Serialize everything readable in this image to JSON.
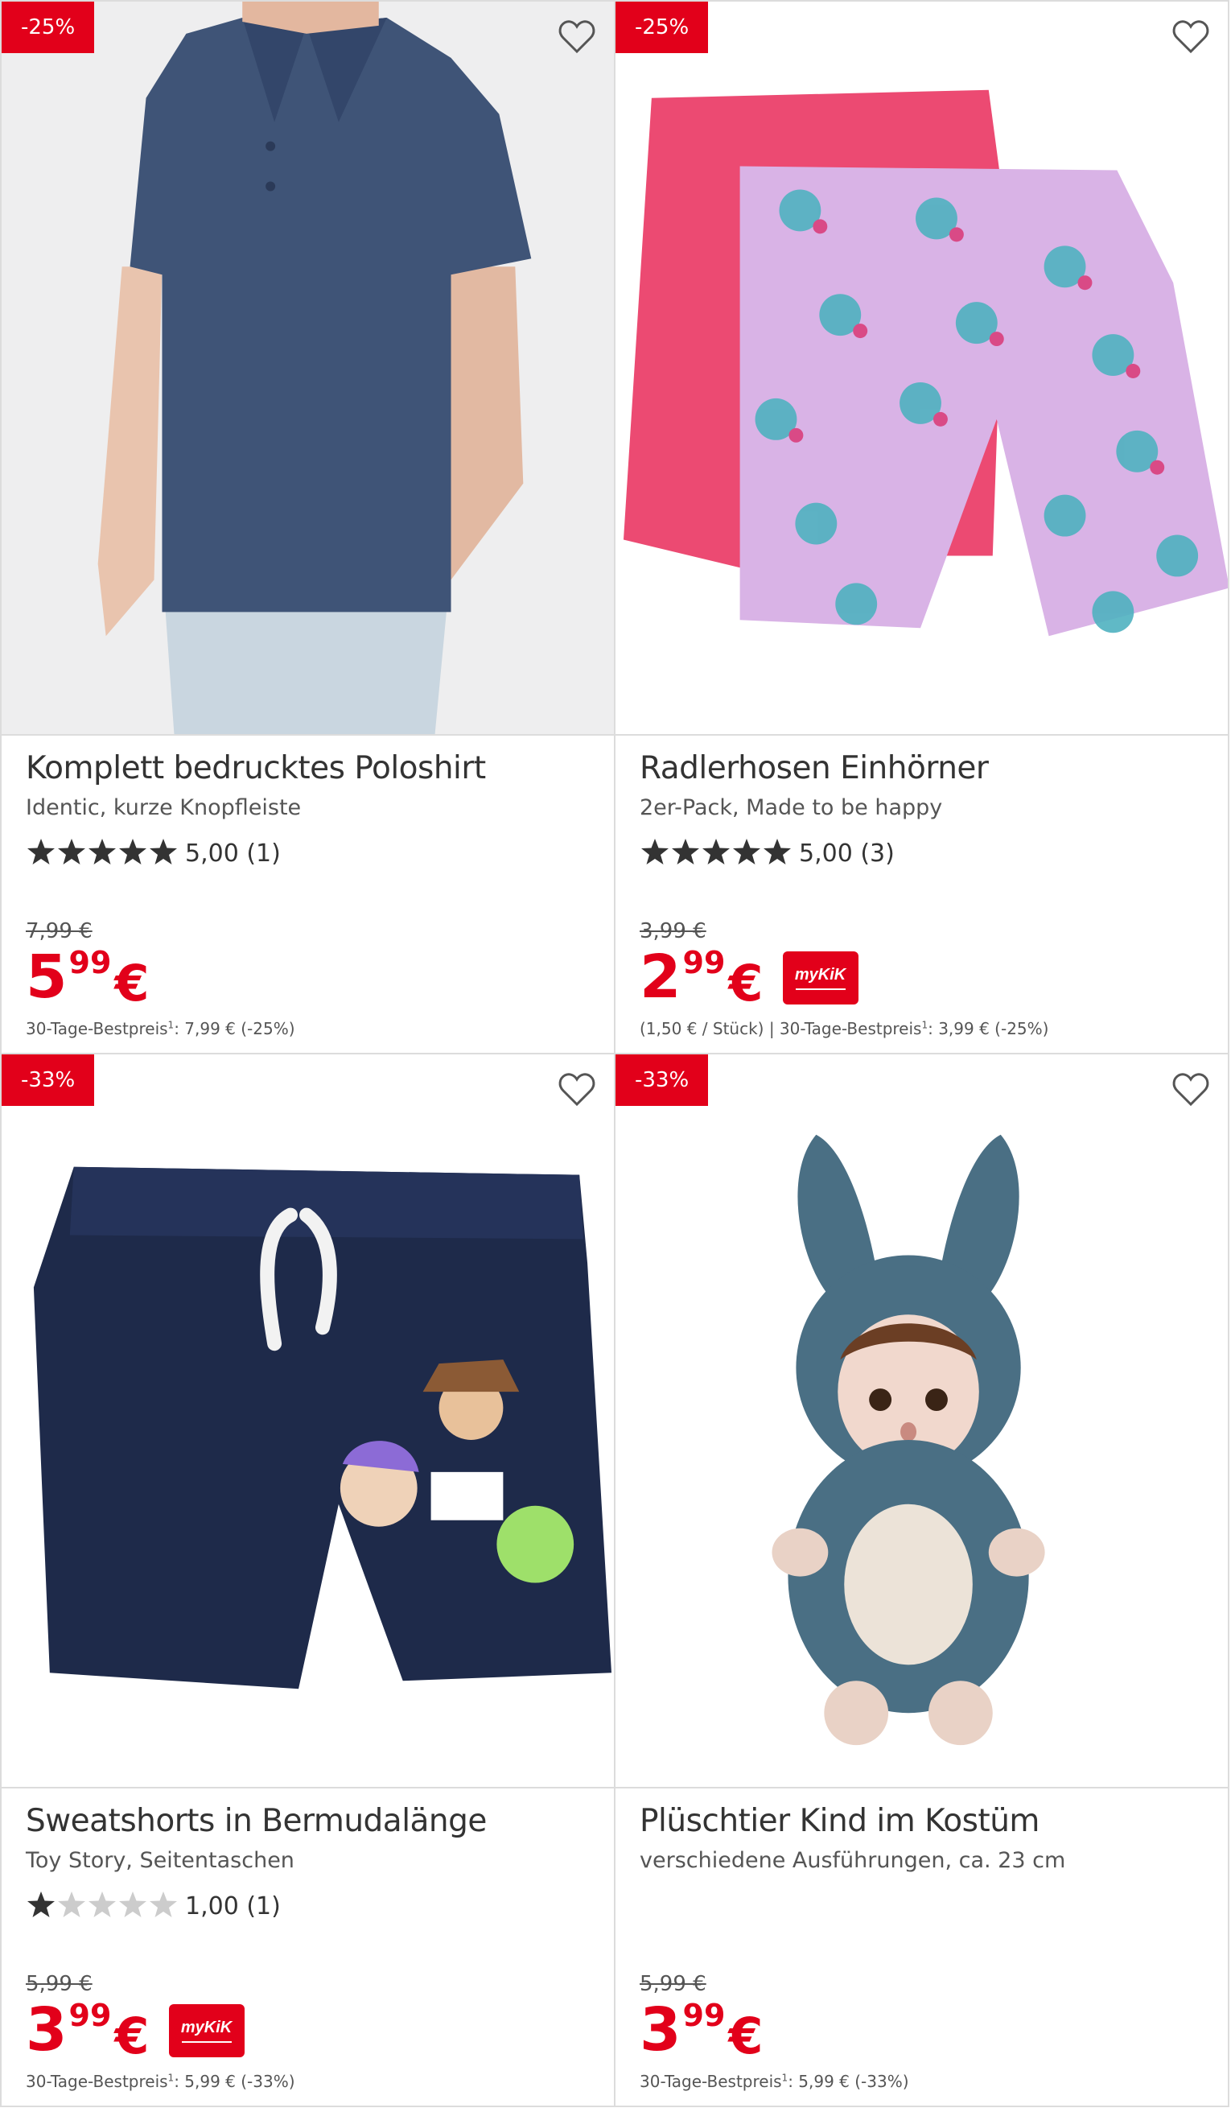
{
  "products": [
    {
      "badge": "-25%",
      "title": "Komplett bedrucktes Poloshirt",
      "subtitle": "Identic, kurze Knopfleiste",
      "rating_value": 5,
      "rating_text": "5,00",
      "rating_count": "(1)",
      "old_price": "7,99 €",
      "price_int": "5",
      "price_cents": "99",
      "currency": "€",
      "mykik": false,
      "footnote_prefix": "",
      "footnote_label": "30-Tage-Bestpreis",
      "footnote_sup": "1",
      "footnote_value": ": 7,99 € (-25%)",
      "image": "navy-polo-shirt"
    },
    {
      "badge": "-25%",
      "title": "Radlerhosen Einhörner",
      "subtitle": "2er-Pack, Made to be happy",
      "rating_value": 5,
      "rating_text": "5,00",
      "rating_count": "(3)",
      "old_price": "3,99 €",
      "price_int": "2",
      "price_cents": "99",
      "currency": "€",
      "mykik": true,
      "footnote_prefix": "(1,50 € / Stück)  |  ",
      "footnote_label": "30-Tage-Bestpreis",
      "footnote_sup": "1",
      "footnote_value": ": 3,99 € (-25%)",
      "image": "unicorn-cycling-shorts"
    },
    {
      "badge": "-33%",
      "title": "Sweatshorts in Bermudalänge",
      "subtitle": "Toy Story, Seitentaschen",
      "rating_value": 1,
      "rating_text": "1,00",
      "rating_count": "(1)",
      "old_price": "5,99 €",
      "price_int": "3",
      "price_cents": "99",
      "currency": "€",
      "mykik": true,
      "footnote_prefix": "",
      "footnote_label": "30-Tage-Bestpreis",
      "footnote_sup": "1",
      "footnote_value": ": 5,99 € (-33%)",
      "image": "toy-story-shorts"
    },
    {
      "badge": "-33%",
      "title": "Plüschtier Kind im Kostüm",
      "subtitle": "verschiedene Ausführungen, ca. 23 cm",
      "rating_value": 0,
      "rating_text": "",
      "rating_count": "",
      "old_price": "5,99 €",
      "price_int": "3",
      "price_cents": "99",
      "currency": "€",
      "mykik": false,
      "footnote_prefix": "",
      "footnote_label": "30-Tage-Bestpreis",
      "footnote_sup": "1",
      "footnote_value": ": 5,99 € (-33%)",
      "image": "plush-bunny-costume"
    }
  ],
  "mykik_label": "myKiK",
  "colors": {
    "accent": "#e2001a",
    "border": "#dcdcdc",
    "star_filled": "#333333",
    "star_empty": "#cccccc"
  }
}
